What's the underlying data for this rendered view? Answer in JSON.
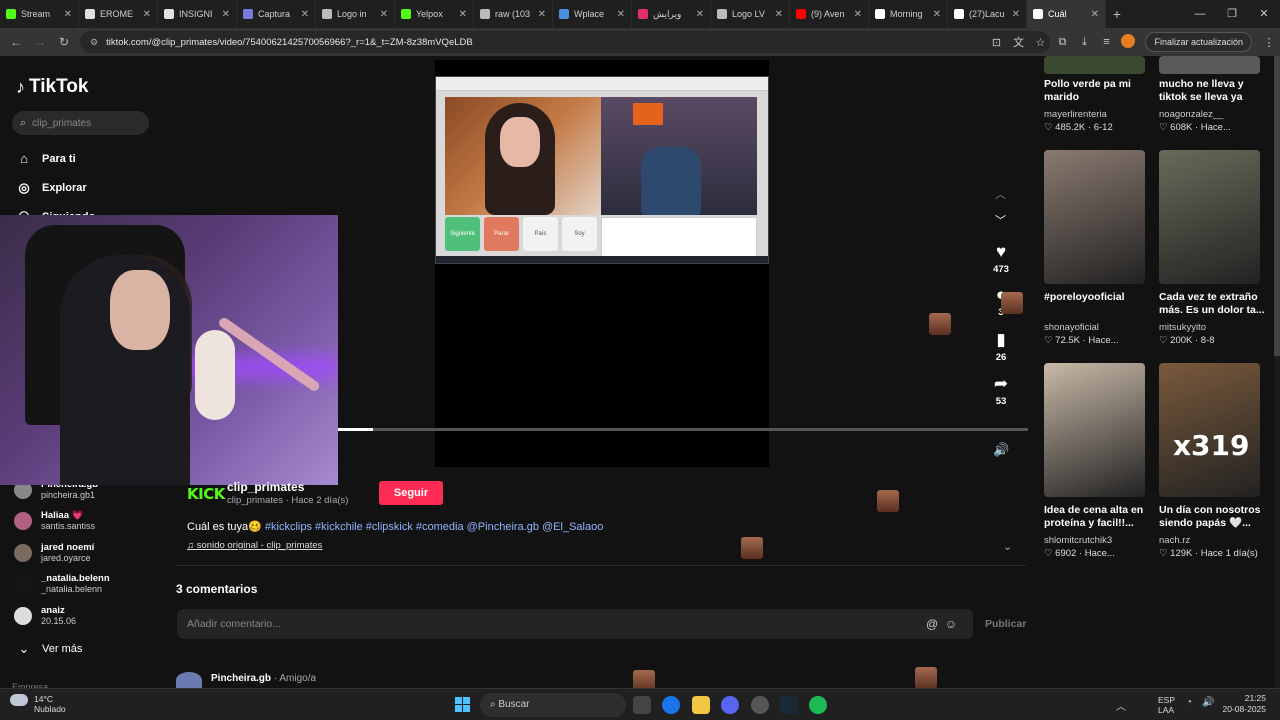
{
  "tabs": [
    {
      "label": "Stream",
      "color": "#53fc18"
    },
    {
      "label": "EROME",
      "color": "#e0e0e0"
    },
    {
      "label": "INSIGNI",
      "color": "#e0e0e0"
    },
    {
      "label": "Captura",
      "color": "#7a7adf"
    },
    {
      "label": "Logo in",
      "color": "#bbbbbb"
    },
    {
      "label": "Yelpox",
      "color": "#53fc18"
    },
    {
      "label": "raw (103",
      "color": "#bbbbbb"
    },
    {
      "label": "Wplace",
      "color": "#4a90e2"
    },
    {
      "label": "ویرایش",
      "color": "#e1306c"
    },
    {
      "label": "Logo LV",
      "color": "#bbbbbb"
    },
    {
      "label": "(9) Aven",
      "color": "#ff0000"
    },
    {
      "label": "Morning",
      "color": "#ffffff"
    },
    {
      "label": "(27)Lacu",
      "color": "#ffffff"
    },
    {
      "label": "Cuál",
      "color": "#ffffff",
      "active": true
    }
  ],
  "browser": {
    "url": "tiktok.com/@clip_primates/video/7540062142570056966?_r=1&_t=ZM-8z38mVQeLDB",
    "update_label": "Finalizar actualización"
  },
  "sidebar": {
    "logo": "TikTok",
    "search_placeholder": "clip_primates",
    "nav": [
      {
        "label": "Para ti",
        "icon": "home-icon"
      },
      {
        "label": "Explorar",
        "icon": "compass-icon"
      },
      {
        "label": "Siguiendo",
        "icon": "people-icon"
      }
    ],
    "following": [
      {
        "name": "Pincheira.gb",
        "user": "pincheira.gb1",
        "color": "#888"
      },
      {
        "name": "Haliaa 💗",
        "user": "santis.santiss",
        "color": "#b06080"
      },
      {
        "name": "jared noemí",
        "user": "jared.oyarce",
        "color": "#7a6a60"
      },
      {
        "name": "_natalia.belenn",
        "user": "_natalia.belenn",
        "color": "#151515"
      },
      {
        "name": "anaiz",
        "user": "20.15.06",
        "color": "#dddddd"
      }
    ],
    "see_more": "Ver más",
    "footer": "Empresa"
  },
  "video": {
    "kick_logo": "KICK",
    "screen_buttons": [
      "Siguiente",
      "Parar",
      "País",
      "Soy"
    ],
    "likes": "473",
    "comments": "3",
    "saves": "26",
    "shares": "53",
    "progress": 0.05
  },
  "post": {
    "author": "clip_primates",
    "author_sub": "clip_primates · Hace 2 día(s)",
    "follow_label": "Seguir",
    "desc_text": "Cuál es tuya🥴",
    "tags": "#kickclips #kickchile #clipskick #comedia @Pincheira.gb @El_Salaoo",
    "sound": "sonido original - clip_primates"
  },
  "comments": {
    "count_label": "3 comentarios",
    "placeholder": "Añadir comentario...",
    "publish": "Publicar",
    "first_user": "Pincheira.gb",
    "first_relation": "· Amigo/a"
  },
  "recommended": [
    {
      "title": "Pollo verde pa mi marido",
      "user": "mayerlirenteria",
      "stats": "♡ 485.2K · 6-12",
      "col": 0,
      "row": 0
    },
    {
      "title": "mucho ne lleva y tiktok se lleva ya",
      "user": "noagonzalez__",
      "stats": "♡ 608K · Hace...",
      "col": 1,
      "row": 0
    },
    {
      "title": "#poreloyooficial",
      "user": "shonayoficial",
      "stats": "♡ 72.5K · Hace...",
      "col": 0,
      "row": 1
    },
    {
      "title": "Cada vez te extraño más. Es un dolor ta...",
      "user": "mitsukyyito",
      "stats": "♡ 200K · 8-8",
      "col": 1,
      "row": 1
    },
    {
      "title": "Idea de cena alta en proteína y facil!!...",
      "user": "shlomitcrutchik3",
      "stats": "♡ 6902 · Hace...",
      "col": 0,
      "row": 2
    },
    {
      "title": "Un día con nosotros siendo papás 🤍...",
      "user": "nach.rz",
      "stats": "♡ 129K · Hace 1 día(s)",
      "col": 1,
      "row": 2
    }
  ],
  "thumb_overlay": "x319",
  "taskbar": {
    "temp": "14°C",
    "condition": "Nublado",
    "search": "Buscar",
    "lang1": "ESP",
    "lang2": "LAA",
    "time": "21:25",
    "date": "20-08-2025"
  }
}
